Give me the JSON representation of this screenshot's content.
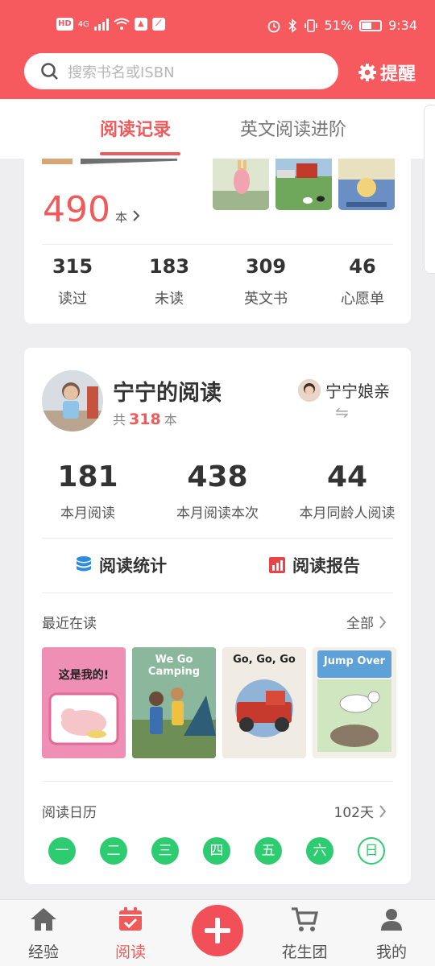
{
  "status_bar": {
    "hd": "HD",
    "network": "4G",
    "battery": "51%",
    "time": "9:34"
  },
  "search": {
    "placeholder": "搜索书名或ISBN"
  },
  "header": {
    "remind_label": "提醒"
  },
  "tabs": [
    {
      "label": "阅读记录",
      "active": true
    },
    {
      "label": "英文阅读进阶",
      "active": false
    }
  ],
  "library": {
    "total": "490",
    "unit": "本",
    "stats": [
      {
        "value": "315",
        "label": "读过"
      },
      {
        "value": "183",
        "label": "未读"
      },
      {
        "value": "309",
        "label": "英文书"
      },
      {
        "value": "46",
        "label": "心愿单"
      }
    ]
  },
  "child": {
    "name": "宁宁的阅读",
    "total_prefix": "共",
    "total": "318",
    "total_unit": "本",
    "parent_name": "宁宁娘亲",
    "swap_icon": "⇋",
    "stats": [
      {
        "value": "181",
        "label": "本月阅读"
      },
      {
        "value": "438",
        "label": "本月阅读本次"
      },
      {
        "value": "44",
        "label": "本月同龄人阅读"
      }
    ],
    "actions": [
      {
        "label": "阅读统计",
        "icon": "database-icon"
      },
      {
        "label": "阅读报告",
        "icon": "report-icon"
      }
    ]
  },
  "recent": {
    "title": "最近在读",
    "all_label": "全部",
    "books": [
      {
        "title": "这是我的!"
      },
      {
        "title": "We Go Camping"
      },
      {
        "title": "Go, Go, Go"
      },
      {
        "title": "Jump Over"
      }
    ]
  },
  "calendar": {
    "title": "阅读日历",
    "days_count": "102天",
    "days": [
      "一",
      "二",
      "三",
      "四",
      "五",
      "六",
      "日"
    ]
  },
  "bottom_nav": [
    {
      "label": "经验",
      "icon": "home-icon",
      "active": false
    },
    {
      "label": "阅读",
      "icon": "calendar-icon",
      "active": true
    },
    {
      "label": "花生团",
      "icon": "cart-icon",
      "active": false
    },
    {
      "label": "我的",
      "icon": "person-icon",
      "active": false
    }
  ],
  "colors": {
    "brand": "#f75a5e",
    "accent": "#f05a5a",
    "calendar_green": "#2ecc71"
  }
}
